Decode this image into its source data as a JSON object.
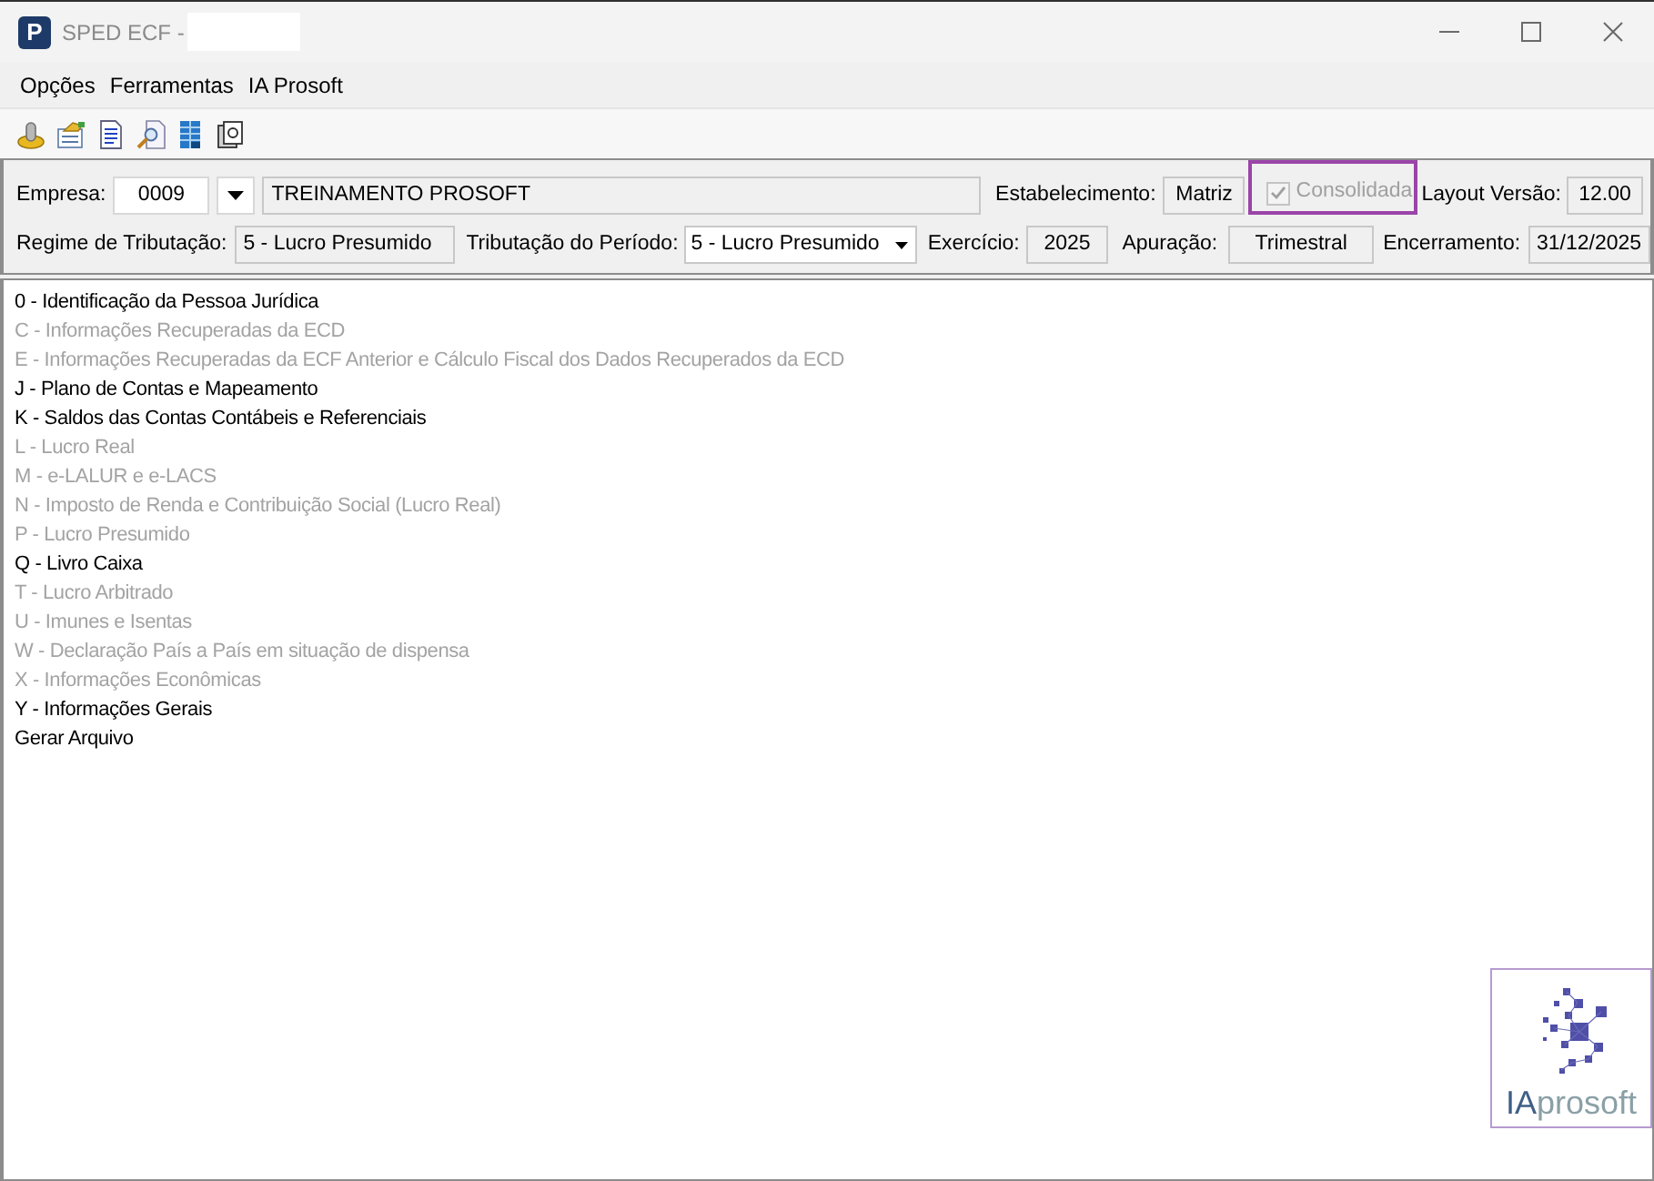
{
  "window": {
    "icon_letter": "P",
    "title": "SPED ECF -"
  },
  "menu": [
    {
      "label": "Opções"
    },
    {
      "label": "Ferramentas"
    },
    {
      "label": "IA Prosoft"
    }
  ],
  "header": {
    "empresa": {
      "label": "Empresa:",
      "code": "0009",
      "name": "TREINAMENTO PROSOFT"
    },
    "estabelecimento": {
      "label": "Estabelecimento:",
      "value": "Matriz"
    },
    "consolidada": {
      "label": "Consolidada",
      "checked": true,
      "disabled": true,
      "highlighted": true
    },
    "layout_versao": {
      "label": "Layout Versão:",
      "value": "12.00"
    },
    "regime_tributacao": {
      "label": "Regime de Tributação:",
      "value": "5 - Lucro Presumido"
    },
    "tributacao_periodo": {
      "label": "Tributação do Período:",
      "value": "5 - Lucro Presumido"
    },
    "exercicio": {
      "label": "Exercício:",
      "value": "2025"
    },
    "apuracao": {
      "label": "Apuração:",
      "value": "Trimestral"
    },
    "encerramento": {
      "label": "Encerramento:",
      "value": "31/12/2025"
    }
  },
  "blocks": [
    {
      "label": "0 - Identificação da Pessoa Jurídica",
      "disabled": false
    },
    {
      "label": "C - Informações Recuperadas da ECD",
      "disabled": true
    },
    {
      "label": "E - Informações Recuperadas da ECF Anterior e Cálculo Fiscal dos Dados Recuperados da ECD",
      "disabled": true
    },
    {
      "label": "J - Plano de Contas e Mapeamento",
      "disabled": false
    },
    {
      "label": "K - Saldos das Contas Contábeis e Referenciais",
      "disabled": false
    },
    {
      "label": "L - Lucro Real",
      "disabled": true
    },
    {
      "label": "M - e-LALUR e e-LACS",
      "disabled": true
    },
    {
      "label": "N - Imposto de Renda e Contribuição Social (Lucro Real)",
      "disabled": true
    },
    {
      "label": "P - Lucro Presumido",
      "disabled": true
    },
    {
      "label": "Q - Livro Caixa",
      "disabled": false
    },
    {
      "label": "T - Lucro Arbitrado",
      "disabled": true
    },
    {
      "label": "U - Imunes e Isentas",
      "disabled": true
    },
    {
      "label": "W - Declaração País a País em situação de dispensa",
      "disabled": true
    },
    {
      "label": "X - Informações Econômicas",
      "disabled": true
    },
    {
      "label": "Y - Informações Gerais",
      "disabled": false
    },
    {
      "label": "Gerar Arquivo",
      "disabled": false
    }
  ],
  "logo": {
    "parts": [
      "IA",
      "prosoft"
    ]
  }
}
